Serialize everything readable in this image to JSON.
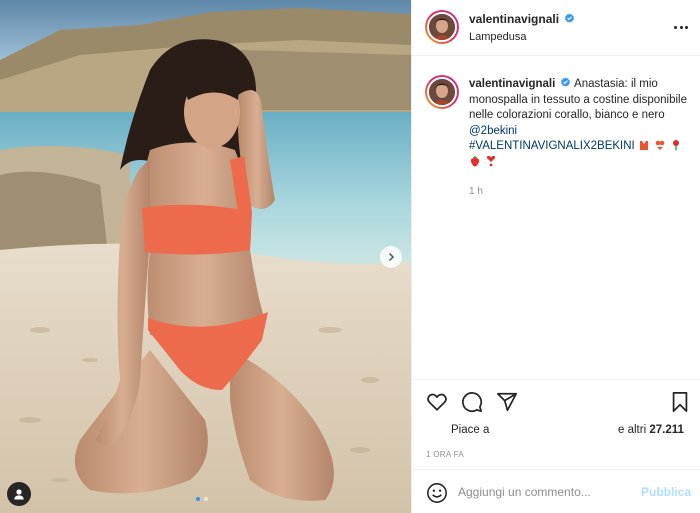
{
  "post": {
    "username": "valentinavignali",
    "location": "Lampedusa",
    "verified": true
  },
  "caption": {
    "username": "valentinavignali",
    "text": "Anastasia: il mio monospalla in tessuto a costine disponibile nelle colorazioni corallo, bianco e nero",
    "mention": "@2bekini",
    "hashtag": "#VALENTINAVIGNALIX2BEKINI",
    "time": "1 h"
  },
  "engagement": {
    "likes_prefix": "Piace a",
    "likes_suffix": "e altri",
    "likes_count": "27.211",
    "post_age": "1 ORA FA"
  },
  "comment": {
    "placeholder": "Aggiungi un commento...",
    "publish_label": "Pubblica"
  },
  "carousel": {
    "total": 2,
    "current": 1
  },
  "icons": {
    "more": "more-icon",
    "verified": "verified-badge-icon",
    "like": "heart-icon",
    "comment": "comment-icon",
    "share": "paper-plane-icon",
    "save": "bookmark-icon",
    "emoji": "smile-icon",
    "next": "chevron-right-icon",
    "tags": "user-tag-icon"
  },
  "colors": {
    "link": "#00376b",
    "verified": "#3897f0",
    "muted": "#8e8e8e",
    "publish_disabled": "#b2dffc"
  }
}
